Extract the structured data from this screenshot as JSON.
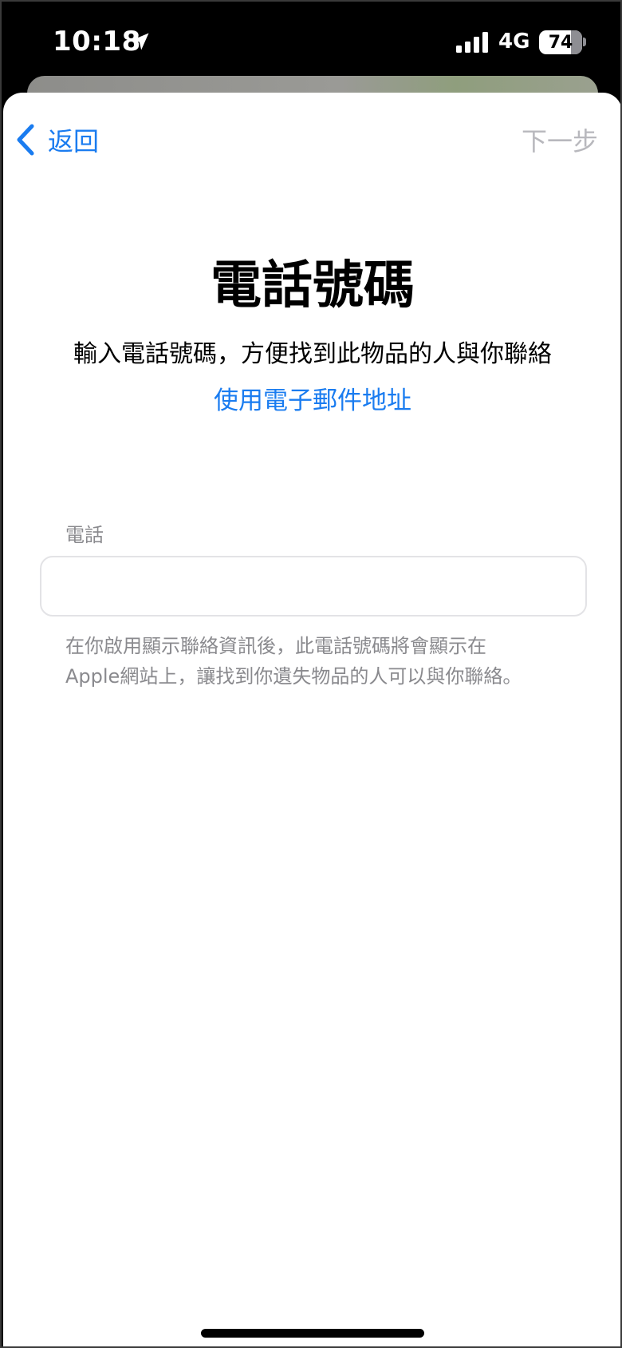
{
  "status_bar": {
    "time": "10:18",
    "network": "4G",
    "battery_percent": "74",
    "battery_level": 0.74,
    "location_icon": "location-arrow-icon",
    "signal_icon": "cellular-signal-icon"
  },
  "nav": {
    "back_label": "返回",
    "next_label": "下一步",
    "back_icon": "chevron-left-icon"
  },
  "main": {
    "title": "電話號碼",
    "subtitle": "輸入電話號碼，方便找到此物品的人與你聯絡",
    "email_link": "使用電子郵件地址",
    "field_label": "電話",
    "field_value": "",
    "field_placeholder": "",
    "field_note_line1": "在你啟用顯示聯絡資訊後，此電話號碼將會顯示在",
    "field_note_line2": "Apple網站上，讓找到你遺失物品的人可以與你聯絡。"
  },
  "colors": {
    "accent": "#1a7cf0",
    "disabled": "#b8b8bd",
    "secondary_text": "#8a8a8e"
  }
}
